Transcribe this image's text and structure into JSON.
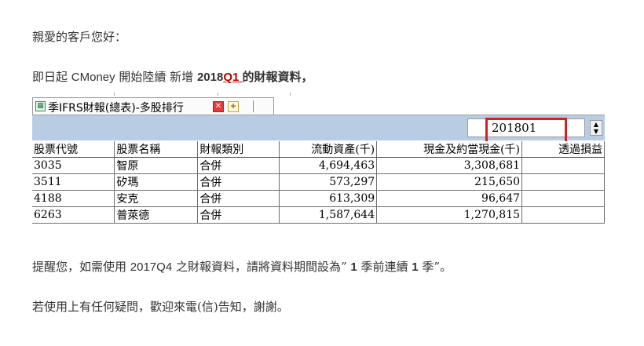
{
  "email": {
    "greeting": "親愛的客戶您好：",
    "intro": {
      "prefix": "即日起 ",
      "brand": "CMoney",
      "mid": " 開始陸續 新增 ",
      "year": "2018",
      "quarter": "Q1 ",
      "suffix": "的財報資料，"
    },
    "reminder": {
      "prefix": "提醒您，如需使用 ",
      "period": "2017Q4",
      "mid": " 之財報資料，請將資料期間設為",
      "quote_open": "” ",
      "setting_1": "1",
      "setting_mid": " 季前連續 ",
      "setting_2": "1",
      "setting_end": " 季",
      "quote_close": "”。"
    },
    "contact": "若使用上有任何疑問，歡迎來電(信)告知，謝謝。"
  },
  "app": {
    "tab_label": "季IFRS財報(總表)-多股排行",
    "tab_icon": "spreadsheet-icon",
    "close_icon": "close-icon",
    "new_tab_icon": "new-tab-icon",
    "period_value": "201801",
    "highlight_color": "#d42020",
    "toolbar_color": "#b8cde4",
    "columns": [
      "股票代號",
      "股票名稱",
      "財報類別",
      "流動資產(千)",
      "現金及約當現金(千)",
      "透過損益"
    ],
    "rows": [
      [
        "3035",
        "智原",
        "合併",
        "4,694,463",
        "3,308,681",
        ""
      ],
      [
        "3511",
        "矽瑪",
        "合併",
        "573,297",
        "215,650",
        ""
      ],
      [
        "4188",
        "安克",
        "合併",
        "613,309",
        "96,647",
        ""
      ],
      [
        "6263",
        "普萊德",
        "合併",
        "1,587,644",
        "1,270,815",
        ""
      ]
    ]
  }
}
